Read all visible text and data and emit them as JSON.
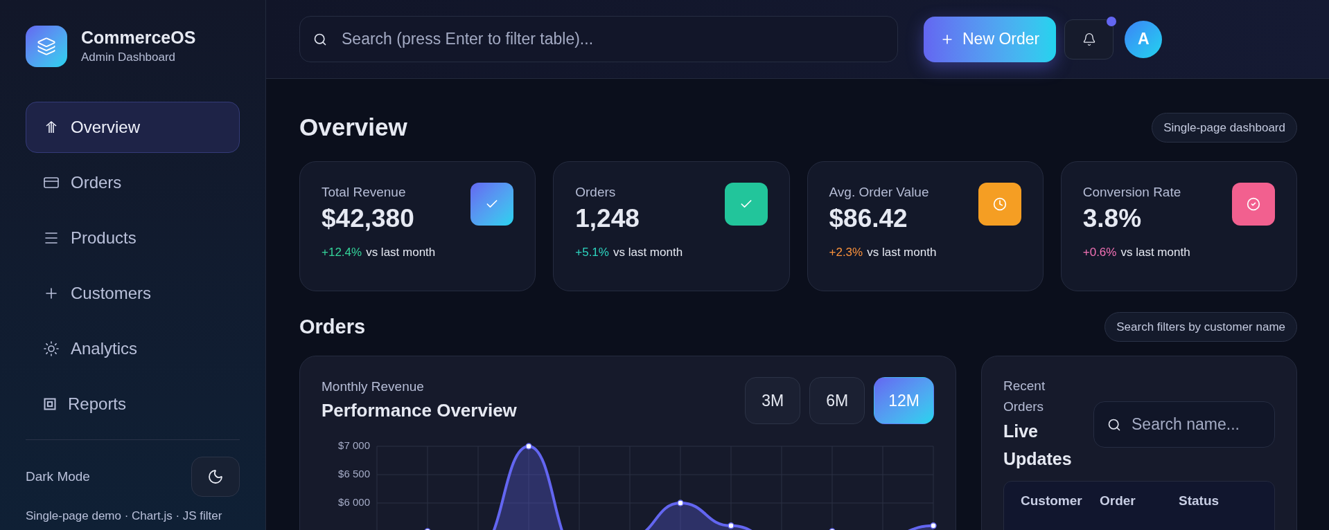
{
  "brand": {
    "name": "CommerceOS",
    "subtitle": "Admin Dashboard"
  },
  "nav": [
    {
      "label": "Overview",
      "selected": true
    },
    {
      "label": "Orders",
      "selected": false
    },
    {
      "label": "Products",
      "selected": false
    },
    {
      "label": "Customers",
      "selected": false
    },
    {
      "label": "Analytics",
      "selected": false
    },
    {
      "label": "Reports",
      "selected": false
    }
  ],
  "theme": {
    "label": "Dark Mode"
  },
  "footer": "Single-page demo · Chart.js · JS filter",
  "search": {
    "placeholder": "Search (press Enter to filter table)..."
  },
  "new_order": "New Order",
  "notifications": {
    "unread": true
  },
  "avatar": "A",
  "overview": {
    "title": "Overview",
    "badge": "Single-page dashboard"
  },
  "stats": [
    {
      "label": "Total Revenue",
      "value": "$42,380",
      "change": "+12.4%",
      "note": "vs last month",
      "color": "#34d399"
    },
    {
      "label": "Orders",
      "value": "1,248",
      "change": "+5.1%",
      "note": "vs last month",
      "color": "#2dd4bf"
    },
    {
      "label": "Avg. Order Value",
      "value": "$86.42",
      "change": "+2.3%",
      "note": "vs last month",
      "color": "#fb923c"
    },
    {
      "label": "Conversion Rate",
      "value": "3.8%",
      "change": "+0.6%",
      "note": "vs last month",
      "color": "#f472b6"
    }
  ],
  "orders": {
    "title": "Orders",
    "badge": "Search filters by customer name"
  },
  "revenue": {
    "subtitle": "Monthly Revenue",
    "title": "Performance Overview",
    "ranges": [
      {
        "label": "3M",
        "selected": false
      },
      {
        "label": "6M",
        "selected": false
      },
      {
        "label": "12M",
        "selected": true
      }
    ],
    "chart_data": {
      "type": "area",
      "categories": [
        null,
        null,
        null,
        null,
        null,
        null,
        null,
        null,
        null,
        null,
        null,
        null
      ],
      "series": [
        {
          "color": "#6366f1",
          "values": [
            5300,
            5500,
            5200,
            7000,
            5100,
            5400,
            6000,
            5600,
            5300,
            5500,
            5400,
            5600
          ]
        }
      ],
      "ylim": [
        4800,
        7000
      ],
      "yticks": [
        {
          "value": 6000,
          "label": "$6 000"
        },
        {
          "value": 6500,
          "label": "$6 500"
        },
        {
          "value": 7000,
          "label": "$7 000"
        }
      ],
      "grid": true
    }
  },
  "recent": {
    "subtitle": "Recent Orders",
    "title": "Live Updates",
    "search_placeholder": "Search name...",
    "columns": [
      "Customer",
      "Order",
      "Status"
    ]
  }
}
